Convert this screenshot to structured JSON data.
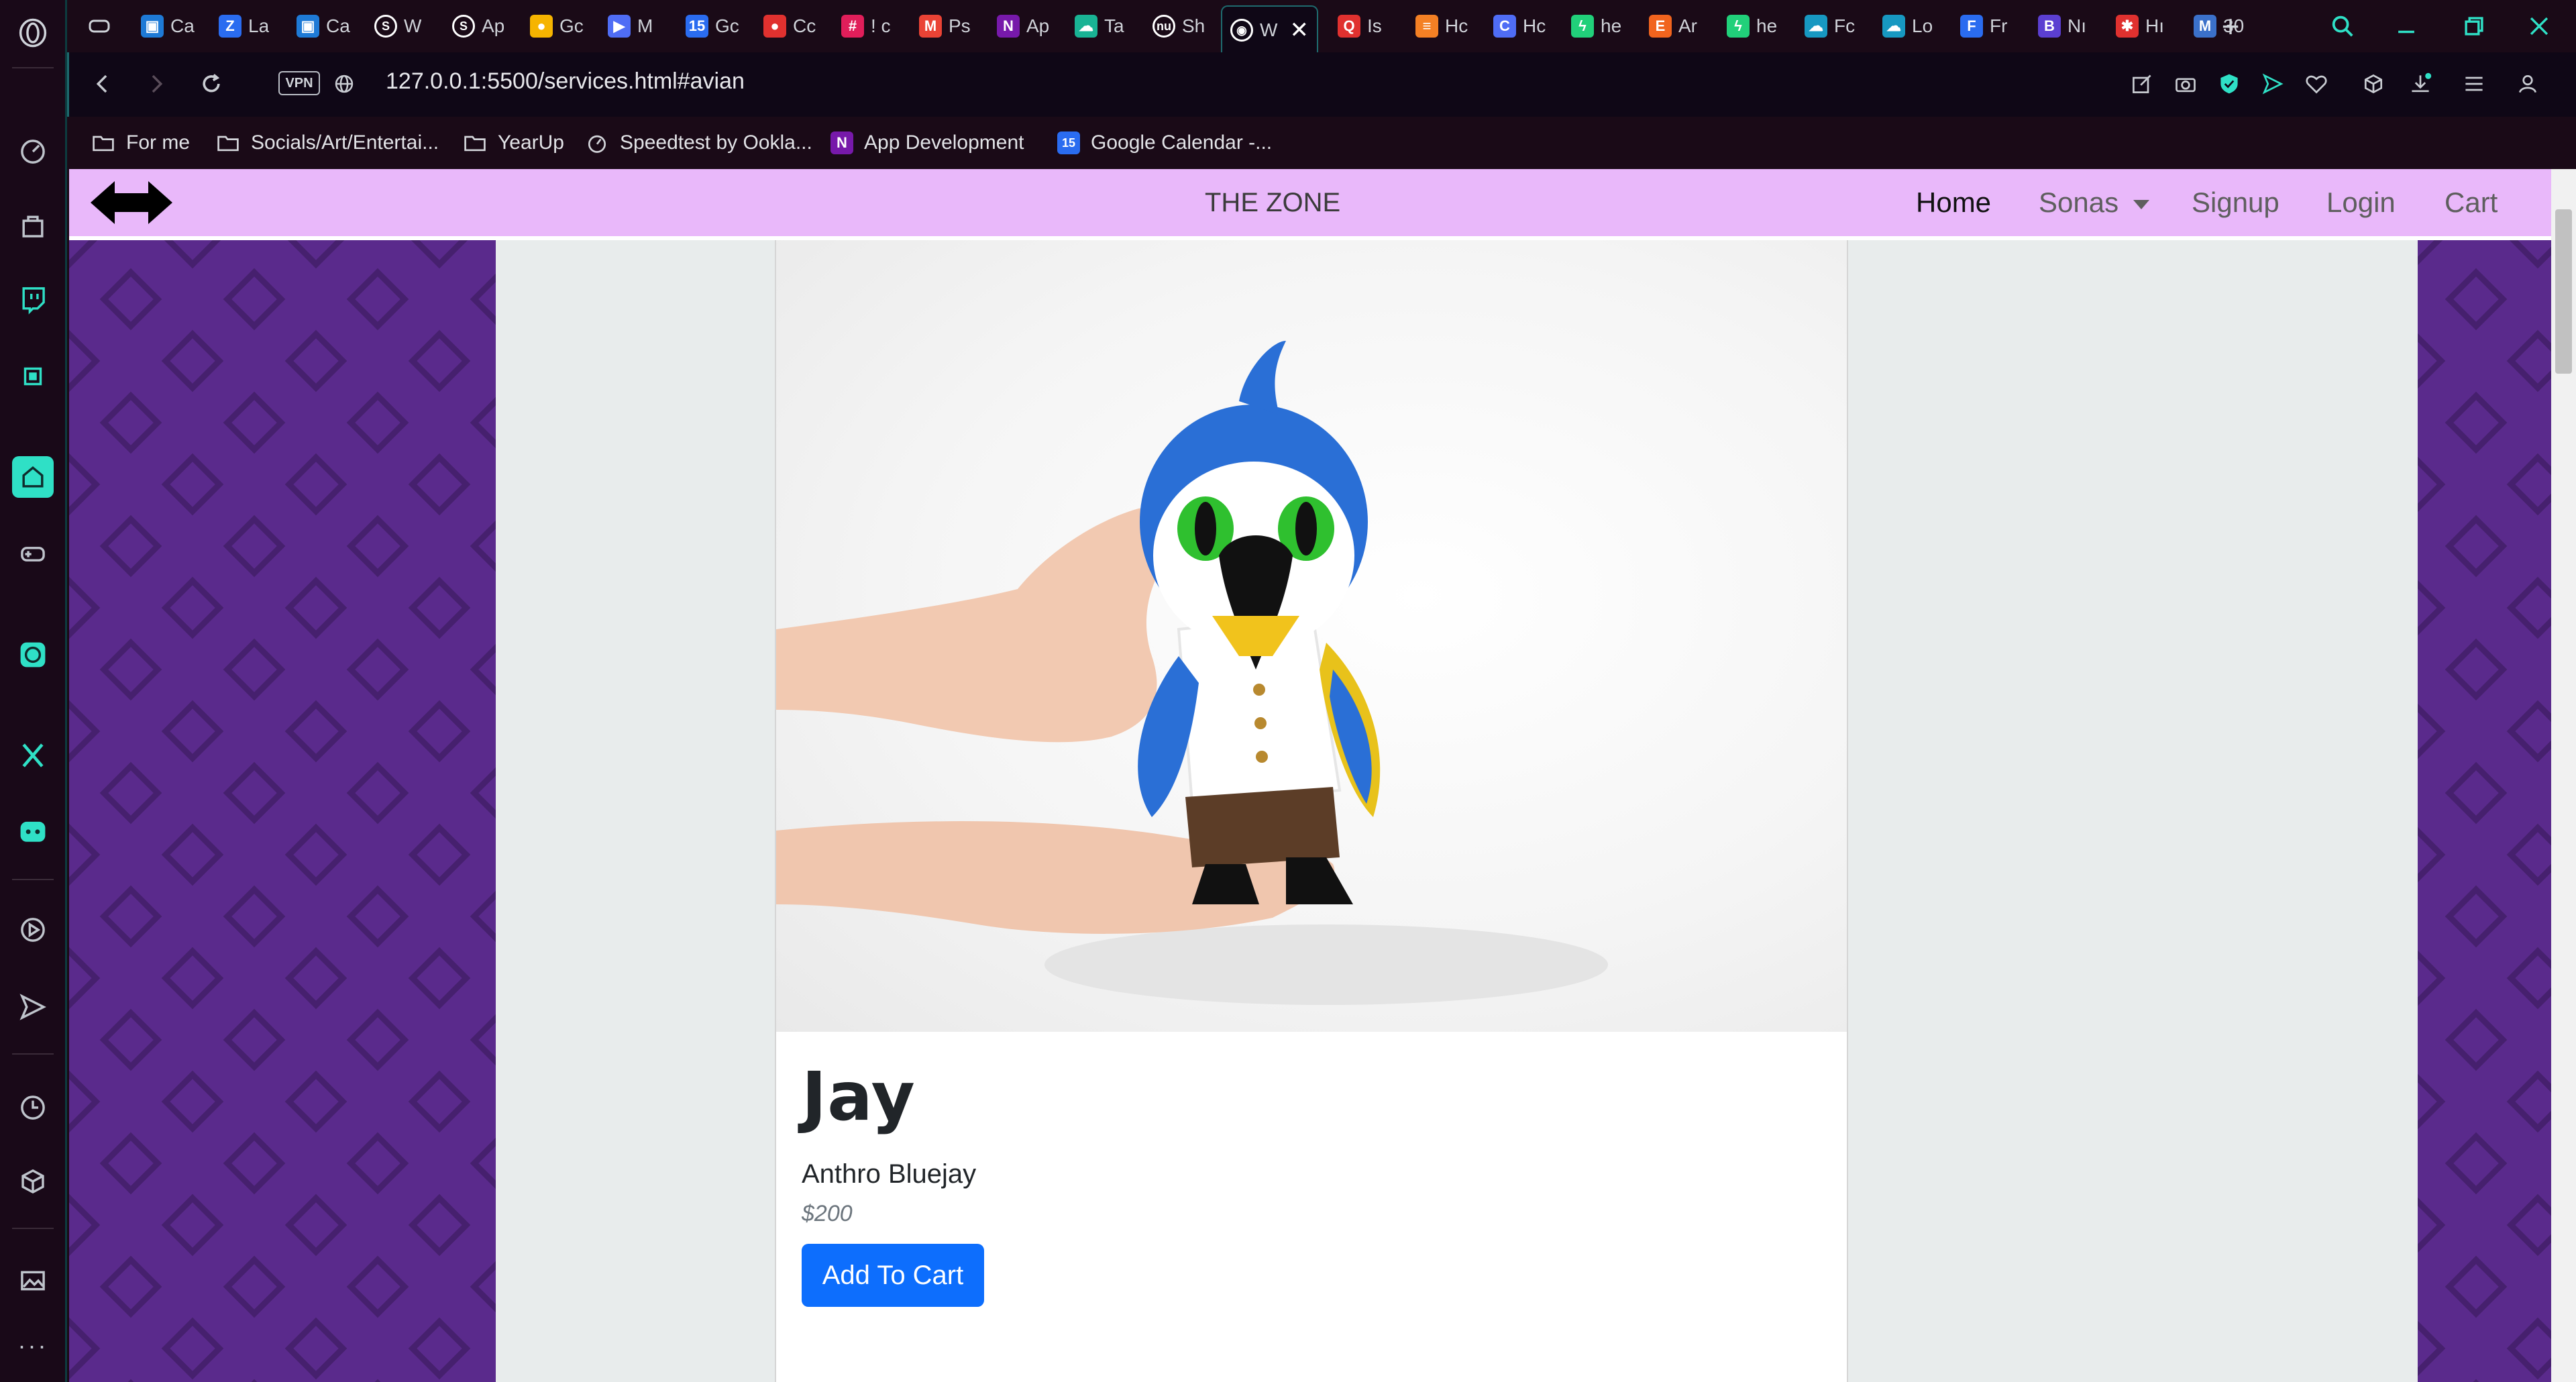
{
  "browser": {
    "tabs": [
      {
        "label": "Ca",
        "icon": "windows-icon",
        "color": "#1e7ad6"
      },
      {
        "label": "La",
        "icon": "z-icon",
        "color": "#2a6cf0"
      },
      {
        "label": "Ca",
        "icon": "windows-icon",
        "color": "#1e7ad6"
      },
      {
        "label": "W",
        "icon": "s-icon",
        "color": "#ffffff"
      },
      {
        "label": "Ap",
        "icon": "s-icon",
        "color": "#ffffff"
      },
      {
        "label": "Gc",
        "icon": "keep-icon",
        "color": "#f6b400"
      },
      {
        "label": "M",
        "icon": "play-icon",
        "color": "#4f6df5"
      },
      {
        "label": "Gc",
        "icon": "calendar-icon",
        "color": "#2a6cf0"
      },
      {
        "label": "Cc",
        "icon": "record-icon",
        "color": "#e0312f"
      },
      {
        "label": "! c",
        "icon": "slack-icon",
        "color": "#e01e5a"
      },
      {
        "label": "Ps",
        "icon": "gmail-icon",
        "color": "#ea4335"
      },
      {
        "label": "Ap",
        "icon": "onenote-icon",
        "color": "#7719aa"
      },
      {
        "label": "Ta",
        "icon": "cloud-icon",
        "color": "#19b394"
      },
      {
        "label": "Sh",
        "icon": "nu-icon",
        "color": "#ffffff"
      },
      {
        "label": "W",
        "icon": "globe-icon",
        "color": "#ffffff"
      },
      {
        "label": "Is",
        "icon": "q-icon",
        "color": "#e0312f"
      },
      {
        "label": "Hc",
        "icon": "stack-icon",
        "color": "#f48024"
      },
      {
        "label": "Hc",
        "icon": "c-icon",
        "color": "#4f6df5"
      },
      {
        "label": "he",
        "icon": "bolt-icon",
        "color": "#21d07a"
      },
      {
        "label": "Ar",
        "icon": "e-icon",
        "color": "#f1641e"
      },
      {
        "label": "he",
        "icon": "bolt-icon",
        "color": "#21d07a"
      },
      {
        "label": "Fc",
        "icon": "salesforce-icon",
        "color": "#1798c1"
      },
      {
        "label": "Lo",
        "icon": "salesforce-icon",
        "color": "#1798c1"
      },
      {
        "label": "Fr",
        "icon": "f-icon",
        "color": "#2a6cf0"
      },
      {
        "label": "Nı",
        "icon": "b-icon",
        "color": "#5b3fd1"
      },
      {
        "label": "Hı",
        "icon": "asterisk-icon",
        "color": "#e0312f"
      },
      {
        "label": "30",
        "icon": "mdb-icon",
        "color": "#3b71ca"
      }
    ],
    "active_tab_index": 14,
    "url": "127.0.0.1:5500/services.html#avian",
    "vpn_label": "VPN",
    "bookmarks": [
      {
        "label": "For me",
        "icon": "folder-icon"
      },
      {
        "label": "Socials/Art/Entertai...",
        "icon": "folder-icon"
      },
      {
        "label": "YearUp",
        "icon": "folder-icon"
      },
      {
        "label": "Speedtest by Ookla...",
        "icon": "speedtest-icon"
      },
      {
        "label": "App Development",
        "icon": "onenote-icon"
      },
      {
        "label": "Google Calendar -...",
        "icon": "calendar-icon"
      }
    ]
  },
  "site": {
    "title": "THE ZONE",
    "nav": [
      {
        "label": "Home",
        "active": true
      },
      {
        "label": "Sonas",
        "dropdown": true
      },
      {
        "label": "Signup"
      },
      {
        "label": "Login"
      },
      {
        "label": "Cart"
      }
    ],
    "colors": {
      "navbar": "#e9b8fa",
      "side": "#5a2a8c",
      "button": "#0d6efd"
    }
  },
  "product": {
    "name": "Jay",
    "description": "Anthro Bluejay",
    "price": "$200",
    "add_to_cart_label": "Add To Cart",
    "image": "bluejay-plush-photo"
  }
}
